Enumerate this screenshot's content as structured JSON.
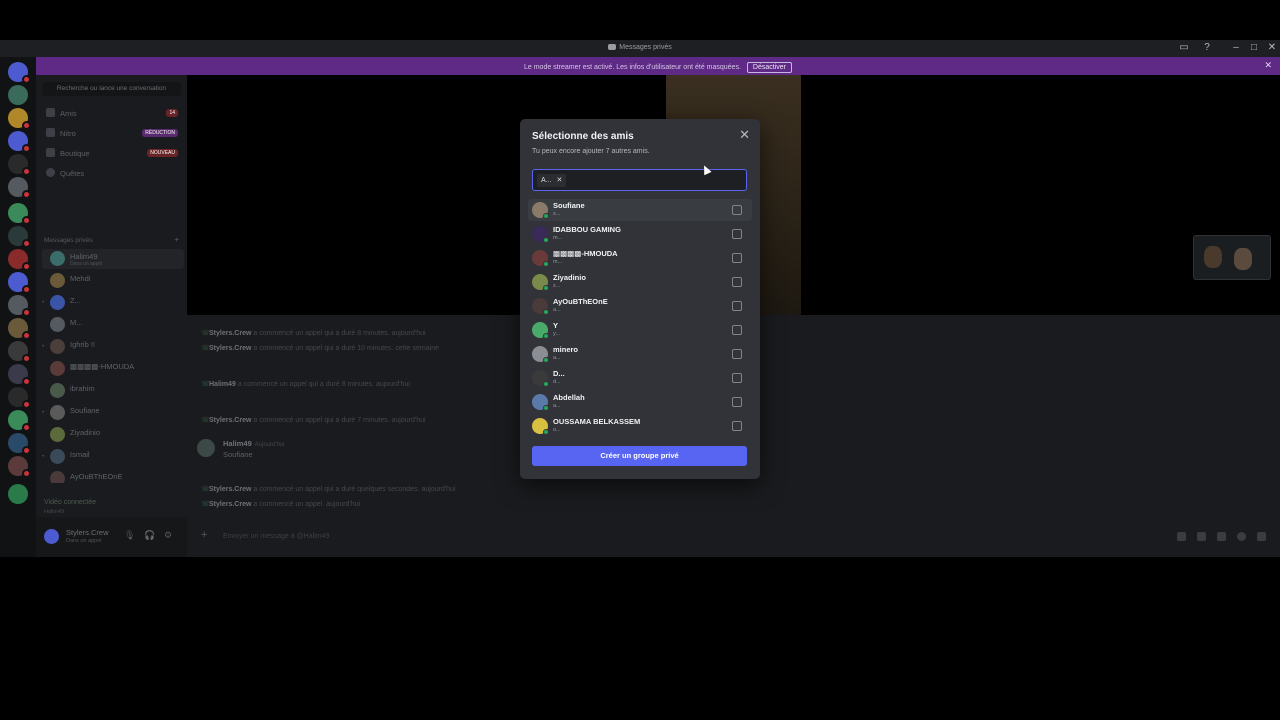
{
  "window": {
    "title": "Messages privés"
  },
  "streamer_banner": {
    "text": "Le mode streamer est activé. Les infos d'utilisateur ont été masquées.",
    "button": "Désactiver"
  },
  "sidebar": {
    "search_placeholder": "Recherche ou lance une conversation",
    "nav": [
      {
        "label": "Amis",
        "badge": "14",
        "badge_color": "#c8343a"
      },
      {
        "label": "Nitro",
        "badge": "RÉDUCTION",
        "badge_color": "#a344c9"
      },
      {
        "label": "Boutique",
        "badge": "NOUVEAU",
        "badge_color": "#c8343a"
      },
      {
        "label": "Quêtes",
        "badge": "",
        "badge_color": ""
      }
    ],
    "dm_header": "Messages privés",
    "dms": [
      {
        "name": "Halim49",
        "sub": "Dans un appel",
        "color": "#3b6d6a"
      },
      {
        "name": "Mehdi",
        "sub": "",
        "color": "#6b5a3a"
      },
      {
        "name": "Z...",
        "sub": "",
        "color": "#3a55a8"
      },
      {
        "name": "M...",
        "sub": "",
        "color": "#555a60"
      },
      {
        "name": "Ighrib !!",
        "sub": "",
        "color": "#4a3f3a"
      },
      {
        "name": "▩▩▩▩-HMOUDA",
        "sub": "",
        "color": "#5b3a3a"
      },
      {
        "name": "ibrahim",
        "sub": "",
        "color": "#4a5a4a"
      },
      {
        "name": "Soufiane",
        "sub": "",
        "color": "#5a5a5a"
      },
      {
        "name": "Ziyadinio",
        "sub": "",
        "color": "#5a6a3a"
      },
      {
        "name": "Ismail",
        "sub": "",
        "color": "#3a4a5a"
      },
      {
        "name": "AyOuBThEOnE",
        "sub": "",
        "color": "#4a3a3a"
      }
    ],
    "voice": {
      "title": "Vidéo connectée",
      "channel": "Halim49"
    },
    "user": {
      "name": "Stylers.Crew",
      "status": "Dans un appel"
    }
  },
  "chat": {
    "messages": [
      {
        "author": "Stylers.Crew",
        "text": "a commencé un appel qui a duré 8 minutes. aujourd'hui"
      },
      {
        "author": "Stylers.Crew",
        "text": "a commencé un appel qui a duré 10 minutes. cette semaine"
      },
      {
        "author": "Halim49",
        "text": "a commencé un appel qui a duré 8 minutes. aujourd'hui"
      },
      {
        "author": "Stylers.Crew",
        "text": "a commencé un appel qui a duré 7 minutes. aujourd'hui"
      },
      {
        "author": "Stylers.Crew",
        "text": "a commencé un appel qui a duré quelques secondes. aujourd'hui"
      },
      {
        "author": "Stylers.Crew",
        "text": "a commencé un appel. aujourd'hui"
      }
    ],
    "big_message": {
      "author": "Halim49",
      "timestamp": "Aujourd'hui",
      "body": "Soufiane"
    },
    "composer_placeholder": "Envoyer un message à @Halim49"
  },
  "modal": {
    "title": "Sélectionne des amis",
    "subtitle": "Tu peux encore ajouter 7 autres amis.",
    "tag": "A...",
    "friends": [
      {
        "name": "Soufiane",
        "tag": "s...",
        "color": "#8a7a6a"
      },
      {
        "name": "IDABBOU GAMING",
        "tag": "m...",
        "color": "#3a2a5a"
      },
      {
        "name": "▩▩▩▩-HMOUDA",
        "tag": "m...",
        "color": "#6a3a3a"
      },
      {
        "name": "Ziyadinio",
        "tag": "z...",
        "color": "#7a8a4a"
      },
      {
        "name": "AyOuBThEOnE",
        "tag": "a...",
        "color": "#4a3a3a"
      },
      {
        "name": "Y",
        "tag": "y...",
        "color": "#4aaa6a"
      },
      {
        "name": "minero",
        "tag": "a...",
        "color": "#8a8d93"
      },
      {
        "name": "D...",
        "tag": "d...",
        "color": "#3a3a3a"
      },
      {
        "name": "Abdellah",
        "tag": "a...",
        "color": "#5a7aaa"
      },
      {
        "name": "OUSSAMA BELKASSEM",
        "tag": "o...",
        "color": "#d8c040"
      }
    ],
    "create_button": "Créer un groupe privé"
  }
}
